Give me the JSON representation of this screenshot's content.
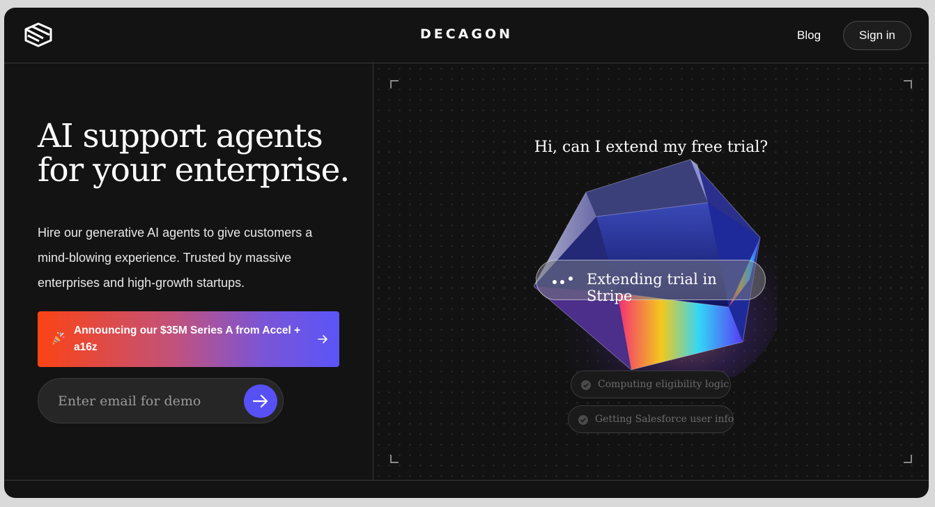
{
  "header": {
    "brand": "DECAGON",
    "nav": {
      "blog": "Blog",
      "sign_in": "Sign in"
    }
  },
  "hero": {
    "title_line1": "AI support agents",
    "title_line2": "for your enterprise.",
    "subtitle": "Hire our generative AI agents to give customers a mind-blowing experience. Trusted by massive enterprises and high-growth startups.",
    "announcement": "Announcing our $35M Series A from Accel + a16z",
    "email_placeholder": "Enter email for demo"
  },
  "demo": {
    "question": "Hi, can I extend my free trial?",
    "status": "Extending trial in Stripe",
    "steps": [
      {
        "label": "Computing eligibility logic",
        "done": true
      },
      {
        "label": "Getting Salesforce user info",
        "done": true
      }
    ]
  },
  "icons": {
    "logo": "logo-icon",
    "announce": "party-popper-icon",
    "arrow": "arrow-right-icon",
    "check": "check-circle-icon",
    "typing": "typing-dots-icon"
  },
  "colors": {
    "background": "#131313",
    "accent": "#5750f5",
    "gradient_start": "#fb4315",
    "gradient_end": "#5b55f7"
  }
}
